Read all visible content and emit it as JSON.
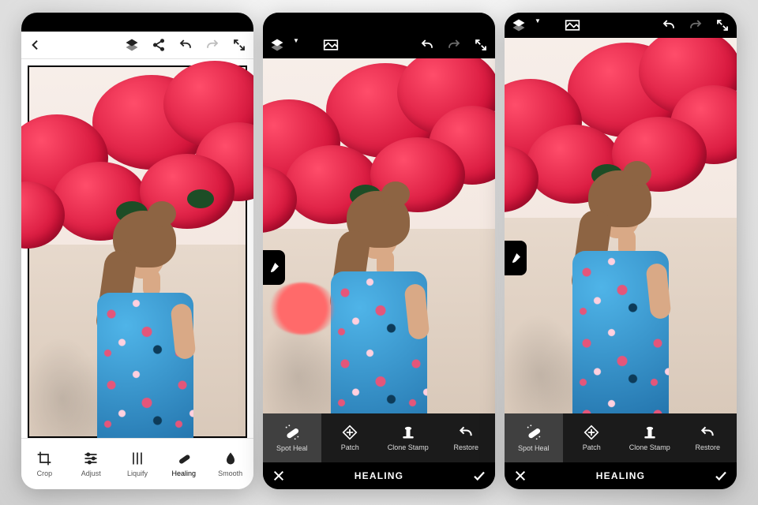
{
  "phone1": {
    "topbar_icons": [
      "back",
      "layers",
      "share",
      "undo",
      "redo",
      "fullscreen"
    ],
    "tools": [
      {
        "key": "crop",
        "label": "Crop"
      },
      {
        "key": "adjust",
        "label": "Adjust"
      },
      {
        "key": "liquify",
        "label": "Liquify"
      },
      {
        "key": "healing",
        "label": "Healing"
      },
      {
        "key": "smooth",
        "label": "Smooth"
      }
    ],
    "active_tool": "healing"
  },
  "phone2": {
    "topbar_icons": [
      "layers",
      "panorama",
      "undo",
      "redo",
      "fullscreen"
    ],
    "mode_title": "HEALING",
    "heal_tools": [
      {
        "key": "spotheal",
        "label": "Spot Heal"
      },
      {
        "key": "patch",
        "label": "Patch"
      },
      {
        "key": "clonestamp",
        "label": "Clone Stamp"
      },
      {
        "key": "restore",
        "label": "Restore"
      }
    ],
    "selected": "spotheal",
    "show_heal_overlay": true
  },
  "phone3": {
    "topbar_icons": [
      "layers",
      "panorama",
      "undo",
      "redo",
      "fullscreen"
    ],
    "mode_title": "HEALING",
    "heal_tools": [
      {
        "key": "spotheal",
        "label": "Spot Heal"
      },
      {
        "key": "patch",
        "label": "Patch"
      },
      {
        "key": "clonestamp",
        "label": "Clone Stamp"
      },
      {
        "key": "restore",
        "label": "Restore"
      }
    ],
    "selected": "spotheal",
    "show_heal_overlay": false
  },
  "confirm_icons": {
    "cancel": "close",
    "accept": "check"
  }
}
